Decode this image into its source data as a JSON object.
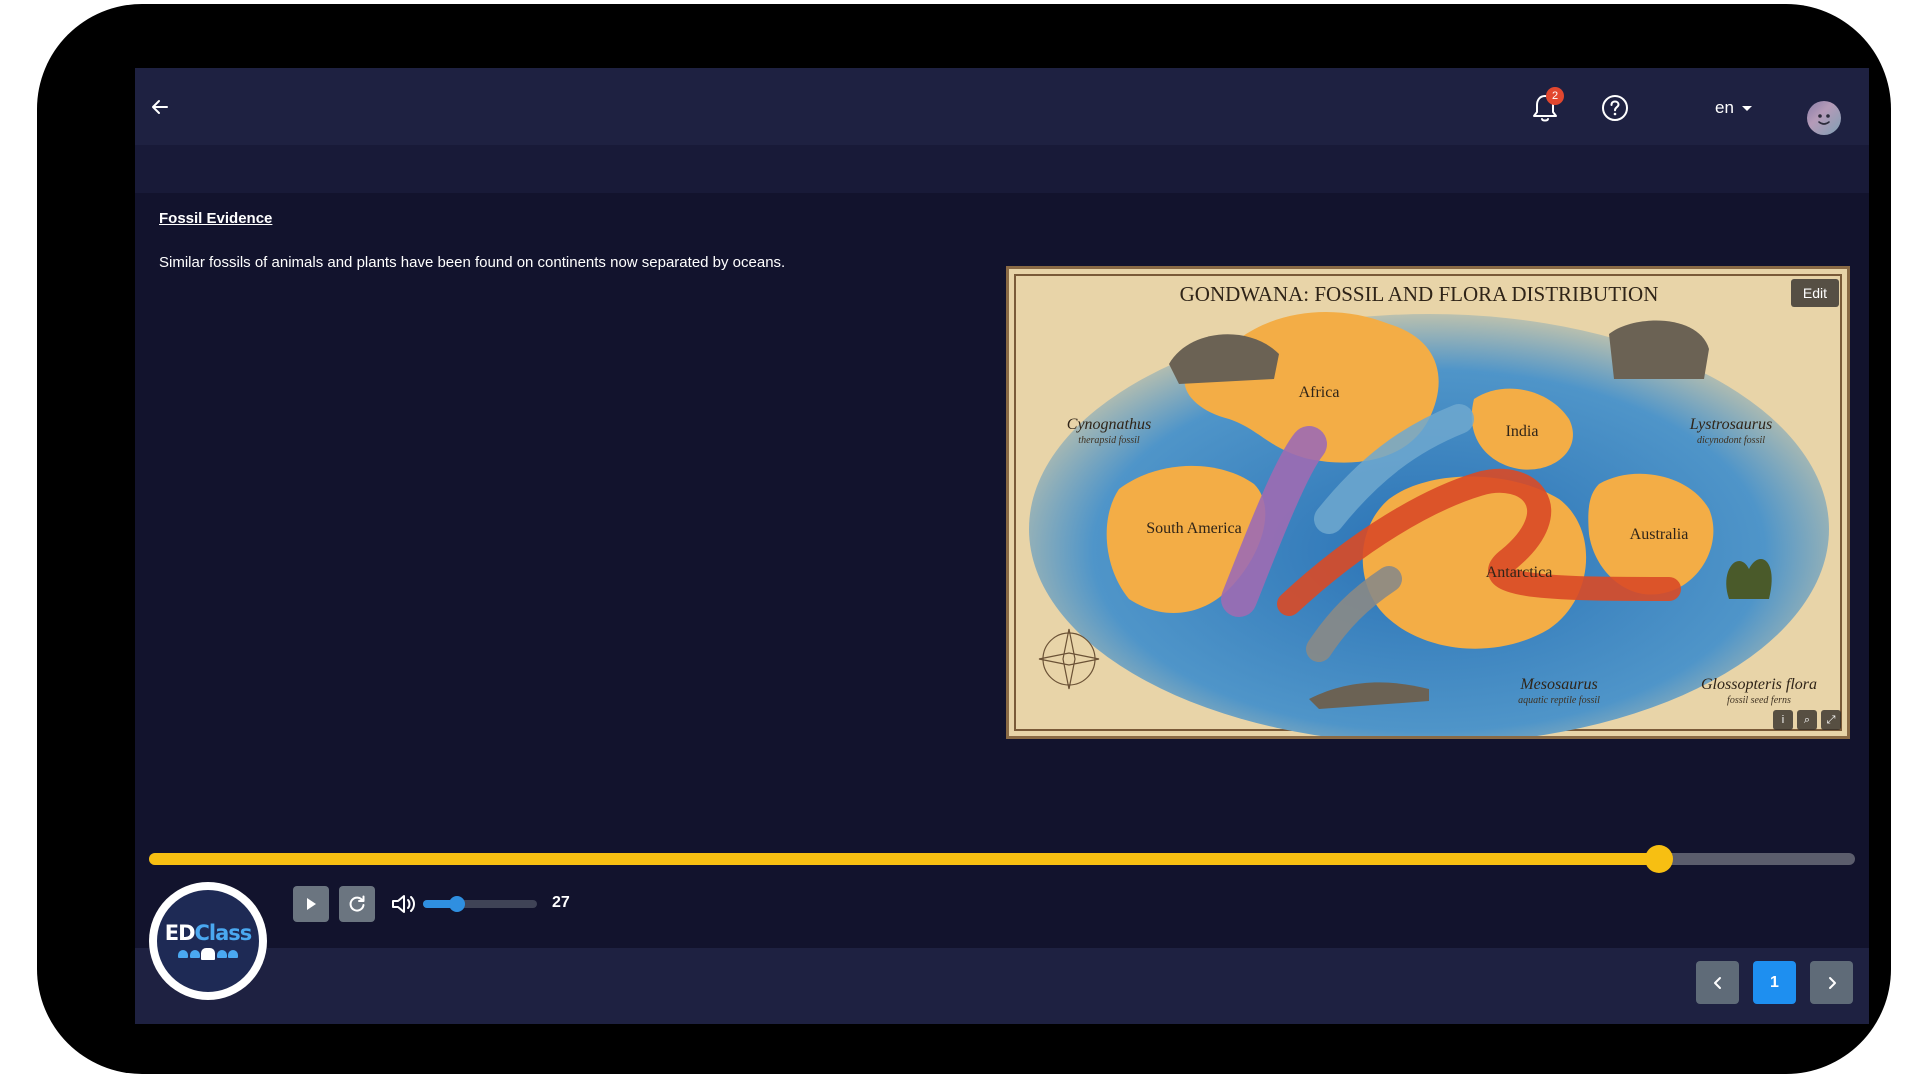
{
  "header": {
    "notifications_count": "2",
    "language": "en"
  },
  "lesson": {
    "section_title": "Fossil Evidence",
    "body": "Similar fossils of animals and plants have been found on continents now separated by oceans."
  },
  "map": {
    "title": "GONDWANA: FOSSIL AND FLORA DISTRIBUTION",
    "edit_label": "Edit",
    "continents": {
      "africa": "Africa",
      "south_america": "South America",
      "india": "India",
      "antarctica": "Antarctica",
      "australia": "Australia"
    },
    "fossils": {
      "cynognathus": "Cynognathus",
      "cynognathus_sub": "therapsid fossil",
      "lystrosaurus": "Lystrosaurus",
      "lystrosaurus_sub": "dicynodont fossil",
      "mesosaurus": "Mesosaurus",
      "mesosaurus_sub": "aquatic reptile fossil",
      "glossopteris": "Glossopteris flora",
      "glossopteris_sub": "fossil seed ferns"
    },
    "tools": [
      "info-icon",
      "zoom-icon",
      "fullscreen-icon"
    ]
  },
  "player": {
    "progress_fraction": 0.885,
    "volume_fraction": 0.3,
    "volume_value": "27"
  },
  "logo": {
    "brand_ed": "ED",
    "brand_class": "Class"
  },
  "pagination": {
    "current_page": "1"
  },
  "colors": {
    "progress": "#f7bf12",
    "accent": "#1e8ff0",
    "badge": "#e2472f"
  }
}
